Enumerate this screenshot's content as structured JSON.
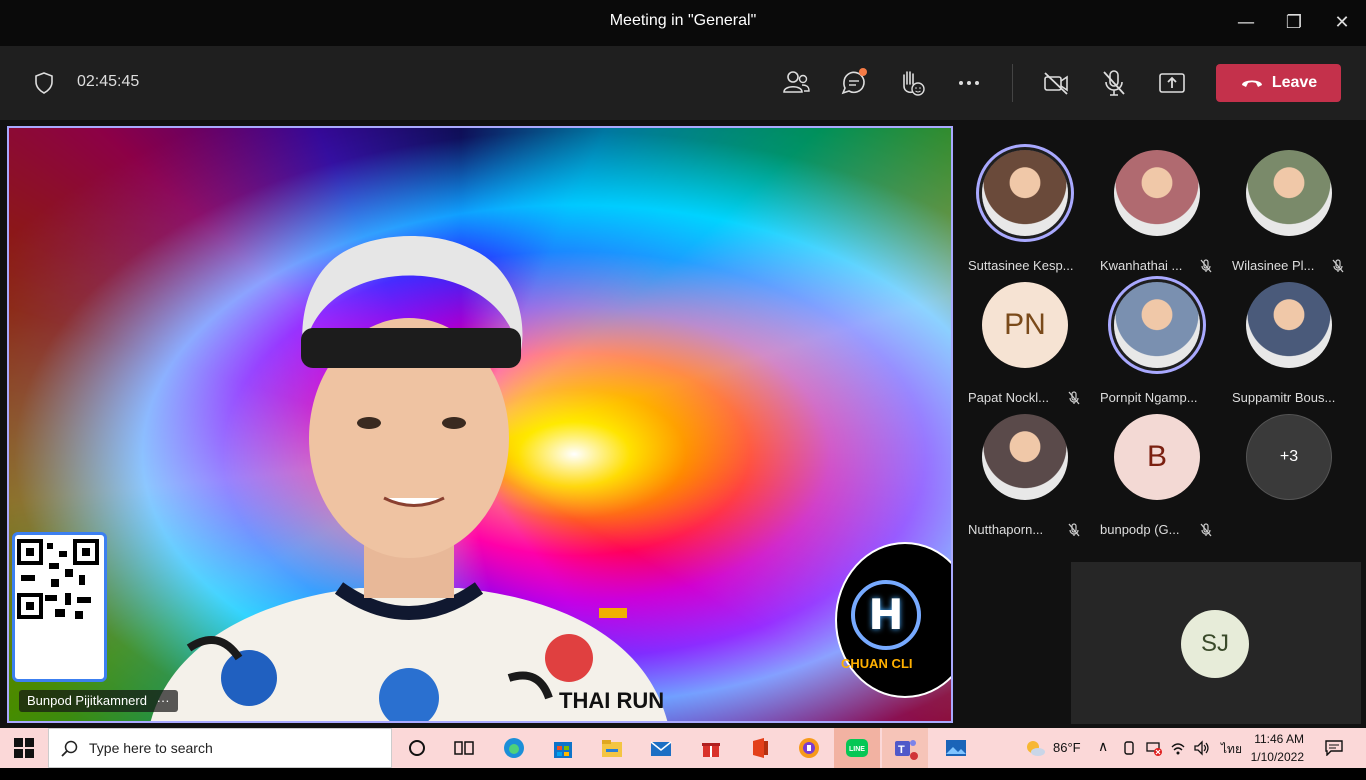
{
  "window": {
    "title": "Meeting in \"General\""
  },
  "toolbar": {
    "timer": "02:45:45",
    "leave_label": "Leave"
  },
  "main_video": {
    "participant_name": "Bunpod Pijitkamnerd",
    "logo_text": "CHUAN CLI",
    "shirt_text": "THAI RUN"
  },
  "participants": [
    {
      "name": "Suttasinee Kesp...",
      "initials": "",
      "muted": false,
      "speaking": true
    },
    {
      "name": "Kwanhathai ...",
      "initials": "",
      "muted": true,
      "speaking": false
    },
    {
      "name": "Wilasinee Pl...",
      "initials": "",
      "muted": true,
      "speaking": false
    },
    {
      "name": "Papat Nockl...",
      "initials": "PN",
      "muted": true,
      "speaking": false
    },
    {
      "name": "Pornpit Ngamp...",
      "initials": "",
      "muted": false,
      "speaking": true
    },
    {
      "name": "Suppamitr Bous...",
      "initials": "",
      "muted": false,
      "speaking": false
    },
    {
      "name": "Nutthaporn...",
      "initials": "",
      "muted": true,
      "speaking": false
    },
    {
      "name": "bunpodp (G...",
      "initials": "B",
      "muted": true,
      "speaking": false
    },
    {
      "name": "",
      "initials": "+3",
      "muted": false,
      "speaking": false
    }
  ],
  "self_tile": {
    "initials": "SJ"
  },
  "taskbar": {
    "search_placeholder": "Type here to search",
    "weather": "86°F",
    "language": "ไทย",
    "time": "11:46 AM",
    "date": "1/10/2022"
  }
}
